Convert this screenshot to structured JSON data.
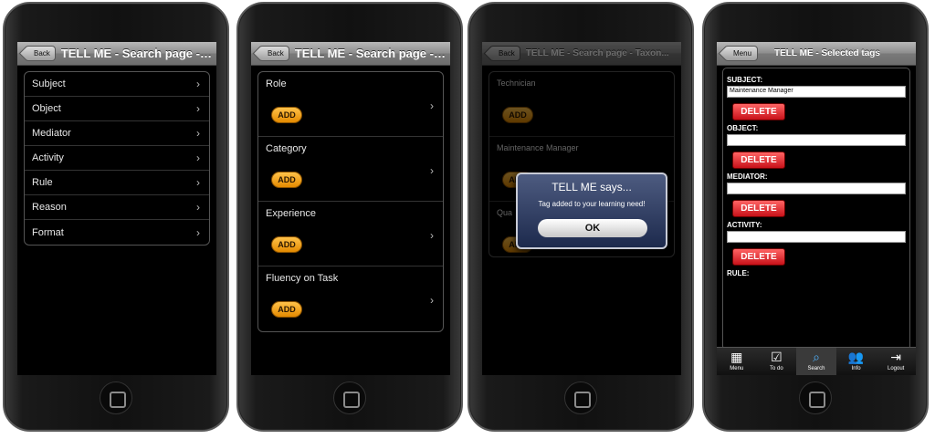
{
  "phone1": {
    "back_label": "Back",
    "title": "TELL ME - Search page - ...",
    "items": [
      "Subject",
      "Object",
      "Mediator",
      "Activity",
      "Rule",
      "Reason",
      "Format"
    ],
    "chevron": "›"
  },
  "phone2": {
    "back_label": "Back",
    "title": "TELL ME - Search page - ...",
    "add_label": "ADD",
    "chevron": "›",
    "items": [
      "Role",
      "Category",
      "Experience",
      "Fluency on Task"
    ]
  },
  "phone3": {
    "back_label": "Back",
    "title": "TELL ME - Search page - Taxon...",
    "add_label": "ADD",
    "items": [
      "Technician",
      "Maintenance Manager",
      "Qua"
    ],
    "dialog": {
      "title": "TELL ME says...",
      "message": "Tag added to your learning need!",
      "ok_label": "OK"
    }
  },
  "phone4": {
    "menu_label": "Menu",
    "title": "TELL ME - Selected tags",
    "delete_label": "DELETE",
    "tags": [
      {
        "label": "SUBJECT:",
        "value": "Maintenance Manager"
      },
      {
        "label": "OBJECT:",
        "value": ""
      },
      {
        "label": "MEDIATOR:",
        "value": ""
      },
      {
        "label": "ACTIVITY:",
        "value": ""
      },
      {
        "label": "RULE:",
        "value": ""
      }
    ],
    "tabs": [
      {
        "label": "Menu",
        "icon": "menu-icon",
        "glyph": "▦"
      },
      {
        "label": "To do",
        "icon": "checklist-icon",
        "glyph": "☑"
      },
      {
        "label": "Search",
        "icon": "search-icon",
        "glyph": "⌕",
        "active": true
      },
      {
        "label": "Info",
        "icon": "info-icon",
        "glyph": "👥"
      },
      {
        "label": "Logout",
        "icon": "logout-icon",
        "glyph": "⇥"
      }
    ]
  }
}
